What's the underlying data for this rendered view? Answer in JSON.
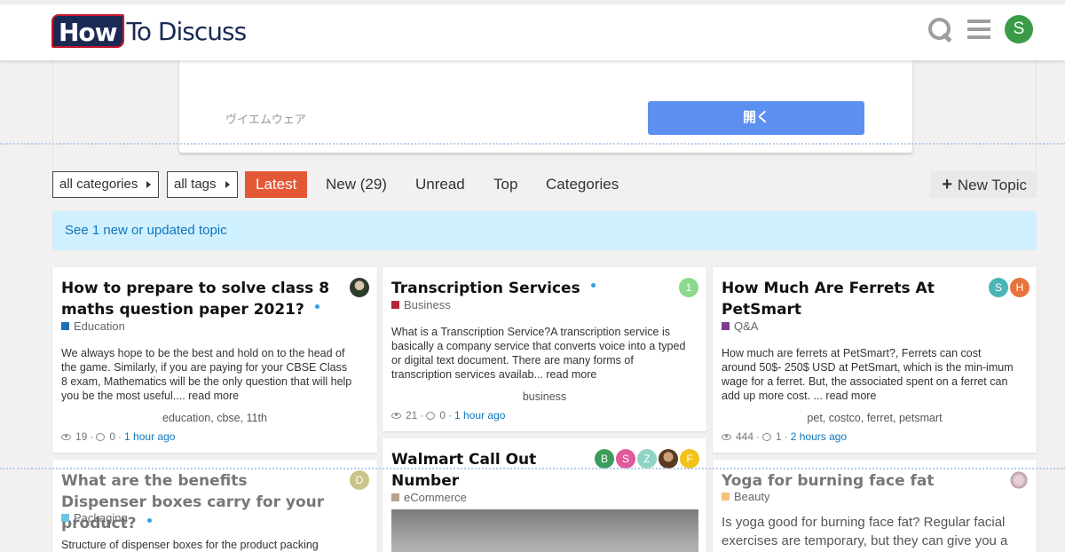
{
  "header": {
    "logo_text_how": "How",
    "logo_text_rest": "To Discuss",
    "user_initial": "S",
    "user_color": "#3a9c48"
  },
  "ad": {
    "label": "ヴイエムウェア",
    "button": "開く"
  },
  "nav": {
    "categories_dropdown": "all categories",
    "tags_dropdown": "all tags",
    "tabs": [
      "Latest",
      "New (29)",
      "Unread",
      "Top",
      "Categories"
    ],
    "new_topic": "New Topic"
  },
  "alert": "See 1 new or updated topic",
  "cards": [
    {
      "title": "How to prepare to solve class 8 maths question paper 2021?",
      "category": "Education",
      "category_color": "#1f6fb5",
      "excerpt": "We always hope to be the best and hold on to the head of the game. Similarly, if you are paying for your CBSE Class 8 exam, Mathematics will be the only question that will help you be the most useful.... ",
      "read_more": "read more",
      "tags": "education,  cbse,  11th",
      "views": "19",
      "replies": "0",
      "time": "1 hour ago"
    },
    {
      "title": "Transcription Services",
      "category": "Business",
      "category_color": "#b3263a",
      "excerpt": "What is a Transcription Service?A transcription service is basically a company service that converts voice into a typed or digital text document. There are many forms of transcription services availab... ",
      "read_more": "read more",
      "tags": "business",
      "views": "21",
      "replies": "0",
      "time": "1 hour ago",
      "avatars": [
        {
          "initial": "1",
          "color": "#8cd98e"
        }
      ]
    },
    {
      "title": "How Much Are Ferrets At PetSmart",
      "category": "Q&A",
      "category_color": "#7a3e91",
      "excerpt": "How much are ferrets at PetSmart?, Ferrets can cost around 50$- 250$ USD at PetSmart, which is the min-imum wage for a ferret. But, the associated spent on a ferret can add up more cost. ... ",
      "read_more": "read more",
      "tags": "pet,  costco,  ferret,  petsmart",
      "views": "444",
      "replies": "1",
      "time": "2 hours ago",
      "avatars": [
        {
          "initial": "S",
          "color": "#4bb5b5"
        },
        {
          "initial": "H",
          "color": "#e8743b"
        }
      ]
    },
    {
      "title": "What are the benefits Dispenser boxes carry for your product?",
      "category": "Packaging",
      "category_color": "#6fc3e8",
      "excerpt": "Structure of dispenser boxes for the product packing",
      "avatars": [
        {
          "initial": "D",
          "color": "#c8c48a"
        }
      ]
    },
    {
      "title": "Walmart Call Out Number",
      "category": "eCommerce",
      "category_color": "#b5a28f",
      "avatars": [
        {
          "initial": "B",
          "color": "#3c9c5a"
        },
        {
          "initial": "S",
          "color": "#e05a9a"
        },
        {
          "initial": "Z",
          "color": "#8fd4c4"
        },
        {
          "initial": "",
          "color": "#7a4a2a"
        },
        {
          "initial": "F",
          "color": "#f2c21a"
        }
      ]
    },
    {
      "title": "Yoga for burning face fat",
      "category": "Beauty",
      "category_color": "#f2c27a",
      "excerpt": "   Is yoga good for burning face fat? Regular facial exercises are temporary, but they can give you a"
    }
  ]
}
